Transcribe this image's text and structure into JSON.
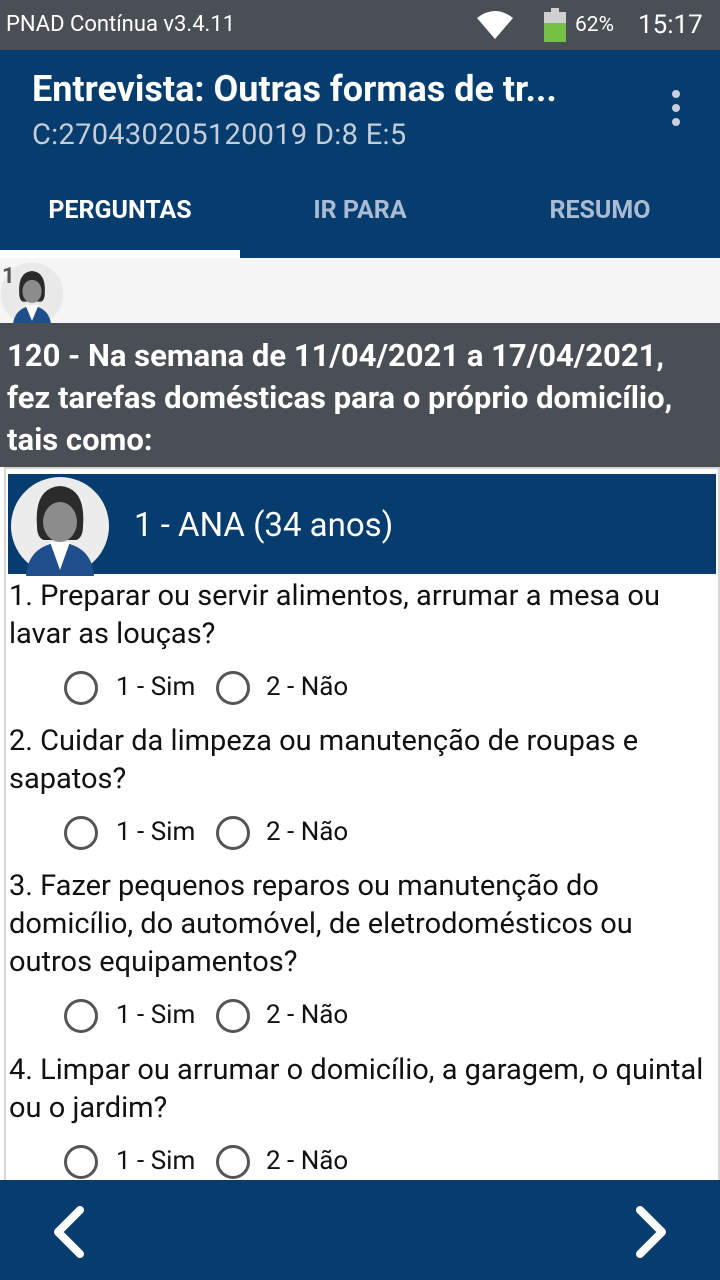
{
  "status_bar": {
    "app_name": "PNAD Contínua v3.4.11",
    "battery": "62%",
    "battery_level": 0.62,
    "time": "15:17"
  },
  "header": {
    "title": "Entrevista: Outras formas de tr...",
    "subtitle": "C:270430205120019 D:8 E:5"
  },
  "tabs": [
    {
      "label": "PERGUNTAS"
    },
    {
      "label": "IR PARA"
    },
    {
      "label": "RESUMO"
    }
  ],
  "person_strip": {
    "number": "1"
  },
  "question": {
    "text": "120 - Na semana de 11/04/2021 a 17/04/2021, fez tarefas domésticas para o próprio domicílio, tais como:"
  },
  "respondent": {
    "name": "1 - ANA (34 anos)"
  },
  "items": [
    {
      "text": "1. Preparar ou servir alimentos, arrumar a mesa ou lavar as louças?",
      "options": [
        "1 - Sim",
        "2 - Não"
      ]
    },
    {
      "text": "2. Cuidar da limpeza ou manutenção de roupas e sapatos?",
      "options": [
        "1 - Sim",
        "2 - Não"
      ]
    },
    {
      "text": "3. Fazer pequenos reparos ou manutenção do domicílio, do automóvel, de eletrodomésticos ou outros equipamentos?",
      "options": [
        "1 - Sim",
        "2 - Não"
      ]
    },
    {
      "text": "4. Limpar ou arrumar o domicílio, a garagem, o quintal ou o jardim?",
      "options": [
        "1 - Sim",
        "2 - Não"
      ]
    }
  ],
  "colors": {
    "primary": "#063d6e",
    "status_bar": "#4a4f55",
    "question_bg": "#4a4f55",
    "battery": "#76c043"
  }
}
